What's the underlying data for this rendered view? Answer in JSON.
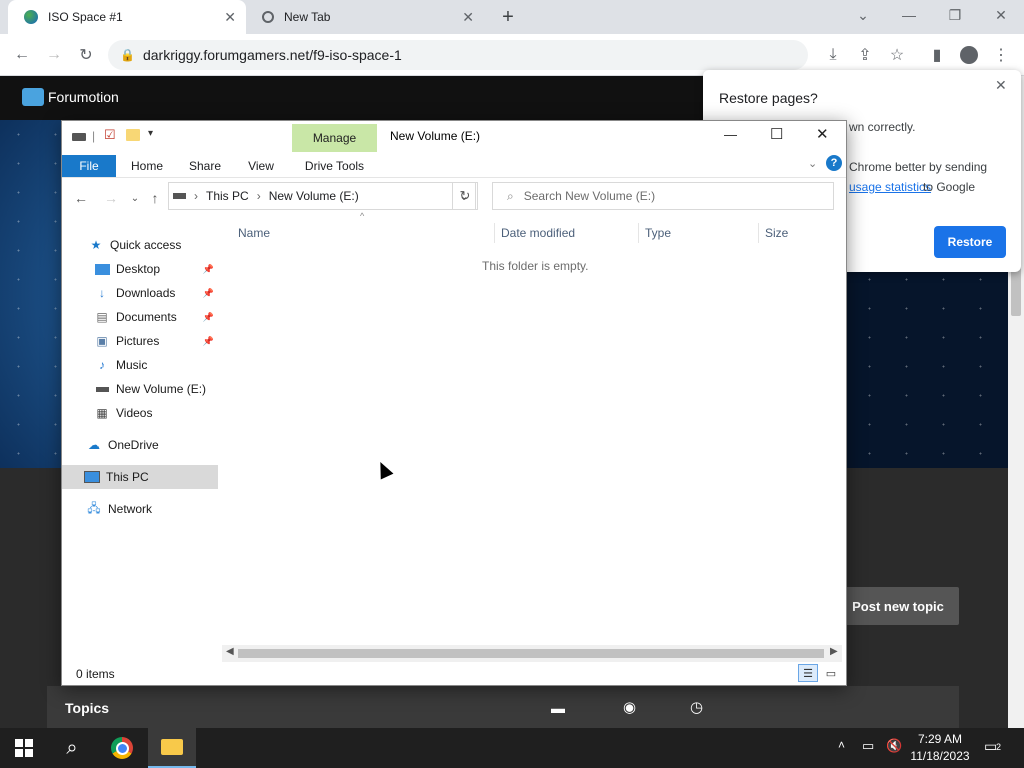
{
  "browser": {
    "tabs": [
      {
        "title": "ISO Space #1"
      },
      {
        "title": "New Tab"
      }
    ],
    "url": "darkriggy.forumgamers.net/f9-iso-space-1"
  },
  "webpage": {
    "site_name": "Forumotion",
    "post_button": "Post new topic",
    "topics_label": "Topics"
  },
  "restore_popup": {
    "title": "Restore pages?",
    "line1": "wn correctly.",
    "line2a": "Chrome better by sending",
    "link": "usage statistics",
    "line2b": " to Google",
    "button": "Restore"
  },
  "explorer": {
    "title": "New Volume (E:)",
    "ribbon_context": "Manage",
    "ribbon_tabs": [
      "File",
      "Home",
      "Share",
      "View",
      "Drive Tools"
    ],
    "breadcrumb": [
      "This PC",
      "New Volume (E:)"
    ],
    "search_placeholder": "Search New Volume (E:)",
    "columns": [
      "Name",
      "Date modified",
      "Type",
      "Size"
    ],
    "empty_message": "This folder is empty.",
    "status": "0 items",
    "nav": {
      "quick_access": "Quick access",
      "items": [
        {
          "label": "Desktop",
          "pinned": true
        },
        {
          "label": "Downloads",
          "pinned": true
        },
        {
          "label": "Documents",
          "pinned": true
        },
        {
          "label": "Pictures",
          "pinned": true
        },
        {
          "label": "Music",
          "pinned": false
        },
        {
          "label": "New Volume (E:)",
          "pinned": false
        },
        {
          "label": "Videos",
          "pinned": false
        }
      ],
      "onedrive": "OneDrive",
      "this_pc": "This PC",
      "network": "Network"
    }
  },
  "taskbar": {
    "time": "7:29 AM",
    "date": "11/18/2023",
    "notifications": "2"
  },
  "colors": {
    "accent": "#1a73e8",
    "explorer_blue": "#1979ca",
    "manage_green": "#c9e7a7"
  }
}
